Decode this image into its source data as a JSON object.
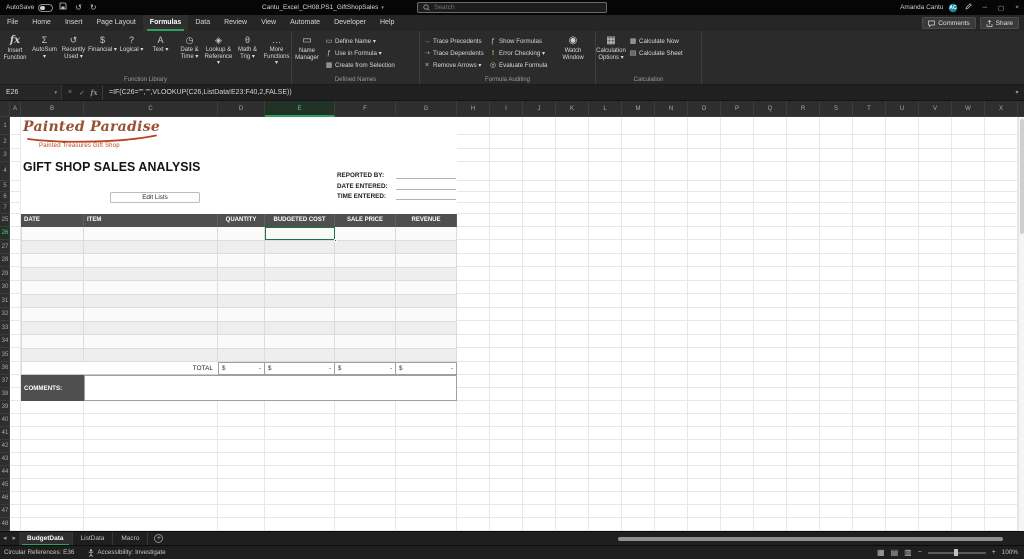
{
  "titlebar": {
    "autosave_label": "AutoSave",
    "autosave_state": "Off",
    "doc_title": "Cantu_Excel_CH08.PS1_GiftShopSales",
    "search_placeholder": "Search",
    "user_name": "Amanda Cantu",
    "user_initials": "AC"
  },
  "ribbon_tabs": {
    "items": [
      {
        "label": "File",
        "active": false
      },
      {
        "label": "Home",
        "active": false
      },
      {
        "label": "Insert",
        "active": false
      },
      {
        "label": "Page Layout",
        "active": false
      },
      {
        "label": "Formulas",
        "active": true
      },
      {
        "label": "Data",
        "active": false
      },
      {
        "label": "Review",
        "active": false
      },
      {
        "label": "View",
        "active": false
      },
      {
        "label": "Automate",
        "active": false
      },
      {
        "label": "Developer",
        "active": false
      },
      {
        "label": "Help",
        "active": false
      }
    ],
    "comments_label": "Comments",
    "share_label": "Share"
  },
  "ribbon": {
    "insert_function_label": "Insert Function",
    "function_library": {
      "group_label": "Function Library",
      "items": [
        "AutoSum",
        "Recently Used",
        "Financial",
        "Logical",
        "Text",
        "Date & Time",
        "Lookup & Reference",
        "Math & Trig",
        "More Functions"
      ]
    },
    "defined_names": {
      "group_label": "Defined Names",
      "name_manager_label": "Name Manager",
      "items": [
        "Define Name",
        "Use in Formula",
        "Create from Selection"
      ]
    },
    "formula_auditing": {
      "group_label": "Formula Auditing",
      "col1": [
        "Trace Precedents",
        "Trace Dependents",
        "Remove Arrows"
      ],
      "col2": [
        "Show Formulas",
        "Error Checking",
        "Evaluate Formula"
      ],
      "watch_window_label": "Watch Window"
    },
    "calculation": {
      "group_label": "Calculation",
      "options_label": "Calculation Options",
      "items": [
        "Calculate Now",
        "Calculate Sheet"
      ]
    }
  },
  "formula_bar": {
    "name_box": "E26",
    "formula": "=IF(C26=\"\",\"\",VLOOKUP(C26,ListData!E23:F40,2,FALSE))"
  },
  "selection": {
    "col": "E",
    "row": "26"
  },
  "grid": {
    "column_headers": [
      "A",
      "B",
      "C",
      "D",
      "E",
      "F",
      "G",
      "H",
      "I",
      "J",
      "K",
      "L",
      "M",
      "N",
      "O",
      "P",
      "Q",
      "R",
      "S",
      "T",
      "U",
      "V",
      "W",
      "X",
      "Y"
    ],
    "row_numbers": [
      "1",
      "2",
      "3",
      "4",
      "5",
      "6",
      "7",
      "25",
      "26",
      "27",
      "28",
      "29",
      "30",
      "31",
      "32",
      "33",
      "34",
      "35",
      "36",
      "37",
      "38",
      "39",
      "40",
      "41",
      "42",
      "43",
      "44",
      "45",
      "46",
      "47",
      "48"
    ]
  },
  "sheet": {
    "logo_title": "Painted Paradise",
    "logo_subtitle": "Painted Treasures Gift Shop",
    "page_title": "GIFT SHOP SALES ANALYSIS",
    "info_labels": [
      "REPORTED BY:",
      "DATE ENTERED:",
      "TIME ENTERED:"
    ],
    "edit_lists_label": "Edit Lists",
    "table": {
      "headers": [
        "DATE",
        "ITEM",
        "QUANTITY",
        "BUDGETED COST",
        "SALE PRICE",
        "REVENUE"
      ],
      "data_row_count": 10,
      "total_label": "TOTAL",
      "total_cells": [
        {
          "symbol": "$",
          "value": "-"
        },
        {
          "symbol": "$",
          "value": "-"
        },
        {
          "symbol": "$",
          "value": "-"
        },
        {
          "symbol": "$",
          "value": "-"
        }
      ],
      "comments_label": "COMMENTS:"
    }
  },
  "sheet_tabs": {
    "tabs": [
      {
        "label": "BudgetData",
        "active": true
      },
      {
        "label": "ListData",
        "active": false
      },
      {
        "label": "Macro",
        "active": false
      }
    ]
  },
  "status_bar": {
    "circular_refs": "Circular References: E36",
    "accessibility": "Accessibility: Investigate",
    "zoom_percent": "100%"
  },
  "colors": {
    "accent_green": "#2F9E5F",
    "selection_green": "#1F7244",
    "logo_red": "#B8431F",
    "table_header_bg": "#4F4F4F"
  },
  "icons": {
    "caret-down": "▾",
    "undo": "↺",
    "redo": "↻",
    "cancel": "×",
    "enter": "✓",
    "insert-function": "fx",
    "autosum": "Σ",
    "recently-used": "↺",
    "financial": "$",
    "logical": "?",
    "text": "A",
    "date-time": "◷",
    "lookup-reference": "◈",
    "math-trig": "θ",
    "more-functions": "…",
    "name-manager": "▭",
    "define-name": "▭",
    "use-in-formula": "ƒ",
    "create-from-selection": "▦",
    "trace-precedents": "→",
    "trace-dependents": "⇢",
    "remove-arrows": "×",
    "show-formulas": "ƒ",
    "error-checking": "!",
    "evaluate-formula": "◎",
    "watch-window": "◉",
    "calculation-options": "▦",
    "calculate-now": "▦",
    "calculate-sheet": "▤",
    "nav-left": "◂",
    "nav-right": "▸",
    "add-sheet": "+",
    "view-normal": "▦",
    "view-page-layout": "▤",
    "view-page-break": "▥",
    "zoom-out": "−",
    "zoom-in": "+",
    "minimize": "─",
    "maximize": "▢",
    "close": "×"
  }
}
